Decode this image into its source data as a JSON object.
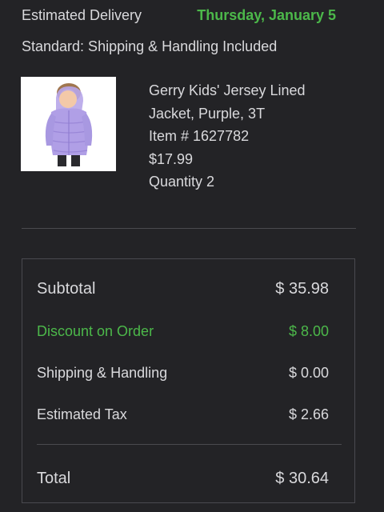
{
  "delivery": {
    "label": "Estimated Delivery",
    "date": "Thursday, January 5",
    "method": "Standard: Shipping & Handling Included"
  },
  "product": {
    "image_alt": "child in purple puffer jacket",
    "name_line1": "Gerry Kids' Jersey Lined",
    "name_line2": "Jacket, Purple, 3T",
    "item_number": "Item # 1627782",
    "price": "$17.99",
    "quantity": "Quantity 2"
  },
  "summary": {
    "subtotal_label": "Subtotal",
    "subtotal_value": "$ 35.98",
    "discount_label": "Discount on Order",
    "discount_value": "$ 8.00",
    "shipping_label": "Shipping & Handling",
    "shipping_value": "$ 0.00",
    "tax_label": "Estimated Tax",
    "tax_value": "$ 2.66",
    "total_label": "Total",
    "total_value": "$ 30.64"
  },
  "colors": {
    "background": "#232326",
    "text": "#d9d9dc",
    "accent_green": "#4cb84a",
    "divider": "#4a4a4f"
  }
}
